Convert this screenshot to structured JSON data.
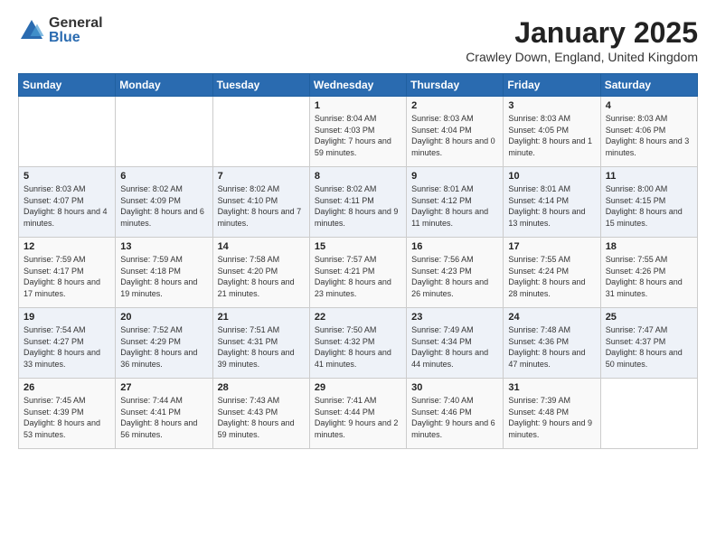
{
  "logo": {
    "general": "General",
    "blue": "Blue"
  },
  "title": "January 2025",
  "subtitle": "Crawley Down, England, United Kingdom",
  "headers": [
    "Sunday",
    "Monday",
    "Tuesday",
    "Wednesday",
    "Thursday",
    "Friday",
    "Saturday"
  ],
  "weeks": [
    [
      {
        "day": "",
        "sunrise": "",
        "sunset": "",
        "daylight": ""
      },
      {
        "day": "",
        "sunrise": "",
        "sunset": "",
        "daylight": ""
      },
      {
        "day": "",
        "sunrise": "",
        "sunset": "",
        "daylight": ""
      },
      {
        "day": "1",
        "sunrise": "Sunrise: 8:04 AM",
        "sunset": "Sunset: 4:03 PM",
        "daylight": "Daylight: 7 hours and 59 minutes."
      },
      {
        "day": "2",
        "sunrise": "Sunrise: 8:03 AM",
        "sunset": "Sunset: 4:04 PM",
        "daylight": "Daylight: 8 hours and 0 minutes."
      },
      {
        "day": "3",
        "sunrise": "Sunrise: 8:03 AM",
        "sunset": "Sunset: 4:05 PM",
        "daylight": "Daylight: 8 hours and 1 minute."
      },
      {
        "day": "4",
        "sunrise": "Sunrise: 8:03 AM",
        "sunset": "Sunset: 4:06 PM",
        "daylight": "Daylight: 8 hours and 3 minutes."
      }
    ],
    [
      {
        "day": "5",
        "sunrise": "Sunrise: 8:03 AM",
        "sunset": "Sunset: 4:07 PM",
        "daylight": "Daylight: 8 hours and 4 minutes."
      },
      {
        "day": "6",
        "sunrise": "Sunrise: 8:02 AM",
        "sunset": "Sunset: 4:09 PM",
        "daylight": "Daylight: 8 hours and 6 minutes."
      },
      {
        "day": "7",
        "sunrise": "Sunrise: 8:02 AM",
        "sunset": "Sunset: 4:10 PM",
        "daylight": "Daylight: 8 hours and 7 minutes."
      },
      {
        "day": "8",
        "sunrise": "Sunrise: 8:02 AM",
        "sunset": "Sunset: 4:11 PM",
        "daylight": "Daylight: 8 hours and 9 minutes."
      },
      {
        "day": "9",
        "sunrise": "Sunrise: 8:01 AM",
        "sunset": "Sunset: 4:12 PM",
        "daylight": "Daylight: 8 hours and 11 minutes."
      },
      {
        "day": "10",
        "sunrise": "Sunrise: 8:01 AM",
        "sunset": "Sunset: 4:14 PM",
        "daylight": "Daylight: 8 hours and 13 minutes."
      },
      {
        "day": "11",
        "sunrise": "Sunrise: 8:00 AM",
        "sunset": "Sunset: 4:15 PM",
        "daylight": "Daylight: 8 hours and 15 minutes."
      }
    ],
    [
      {
        "day": "12",
        "sunrise": "Sunrise: 7:59 AM",
        "sunset": "Sunset: 4:17 PM",
        "daylight": "Daylight: 8 hours and 17 minutes."
      },
      {
        "day": "13",
        "sunrise": "Sunrise: 7:59 AM",
        "sunset": "Sunset: 4:18 PM",
        "daylight": "Daylight: 8 hours and 19 minutes."
      },
      {
        "day": "14",
        "sunrise": "Sunrise: 7:58 AM",
        "sunset": "Sunset: 4:20 PM",
        "daylight": "Daylight: 8 hours and 21 minutes."
      },
      {
        "day": "15",
        "sunrise": "Sunrise: 7:57 AM",
        "sunset": "Sunset: 4:21 PM",
        "daylight": "Daylight: 8 hours and 23 minutes."
      },
      {
        "day": "16",
        "sunrise": "Sunrise: 7:56 AM",
        "sunset": "Sunset: 4:23 PM",
        "daylight": "Daylight: 8 hours and 26 minutes."
      },
      {
        "day": "17",
        "sunrise": "Sunrise: 7:55 AM",
        "sunset": "Sunset: 4:24 PM",
        "daylight": "Daylight: 8 hours and 28 minutes."
      },
      {
        "day": "18",
        "sunrise": "Sunrise: 7:55 AM",
        "sunset": "Sunset: 4:26 PM",
        "daylight": "Daylight: 8 hours and 31 minutes."
      }
    ],
    [
      {
        "day": "19",
        "sunrise": "Sunrise: 7:54 AM",
        "sunset": "Sunset: 4:27 PM",
        "daylight": "Daylight: 8 hours and 33 minutes."
      },
      {
        "day": "20",
        "sunrise": "Sunrise: 7:52 AM",
        "sunset": "Sunset: 4:29 PM",
        "daylight": "Daylight: 8 hours and 36 minutes."
      },
      {
        "day": "21",
        "sunrise": "Sunrise: 7:51 AM",
        "sunset": "Sunset: 4:31 PM",
        "daylight": "Daylight: 8 hours and 39 minutes."
      },
      {
        "day": "22",
        "sunrise": "Sunrise: 7:50 AM",
        "sunset": "Sunset: 4:32 PM",
        "daylight": "Daylight: 8 hours and 41 minutes."
      },
      {
        "day": "23",
        "sunrise": "Sunrise: 7:49 AM",
        "sunset": "Sunset: 4:34 PM",
        "daylight": "Daylight: 8 hours and 44 minutes."
      },
      {
        "day": "24",
        "sunrise": "Sunrise: 7:48 AM",
        "sunset": "Sunset: 4:36 PM",
        "daylight": "Daylight: 8 hours and 47 minutes."
      },
      {
        "day": "25",
        "sunrise": "Sunrise: 7:47 AM",
        "sunset": "Sunset: 4:37 PM",
        "daylight": "Daylight: 8 hours and 50 minutes."
      }
    ],
    [
      {
        "day": "26",
        "sunrise": "Sunrise: 7:45 AM",
        "sunset": "Sunset: 4:39 PM",
        "daylight": "Daylight: 8 hours and 53 minutes."
      },
      {
        "day": "27",
        "sunrise": "Sunrise: 7:44 AM",
        "sunset": "Sunset: 4:41 PM",
        "daylight": "Daylight: 8 hours and 56 minutes."
      },
      {
        "day": "28",
        "sunrise": "Sunrise: 7:43 AM",
        "sunset": "Sunset: 4:43 PM",
        "daylight": "Daylight: 8 hours and 59 minutes."
      },
      {
        "day": "29",
        "sunrise": "Sunrise: 7:41 AM",
        "sunset": "Sunset: 4:44 PM",
        "daylight": "Daylight: 9 hours and 2 minutes."
      },
      {
        "day": "30",
        "sunrise": "Sunrise: 7:40 AM",
        "sunset": "Sunset: 4:46 PM",
        "daylight": "Daylight: 9 hours and 6 minutes."
      },
      {
        "day": "31",
        "sunrise": "Sunrise: 7:39 AM",
        "sunset": "Sunset: 4:48 PM",
        "daylight": "Daylight: 9 hours and 9 minutes."
      },
      {
        "day": "",
        "sunrise": "",
        "sunset": "",
        "daylight": ""
      }
    ]
  ]
}
